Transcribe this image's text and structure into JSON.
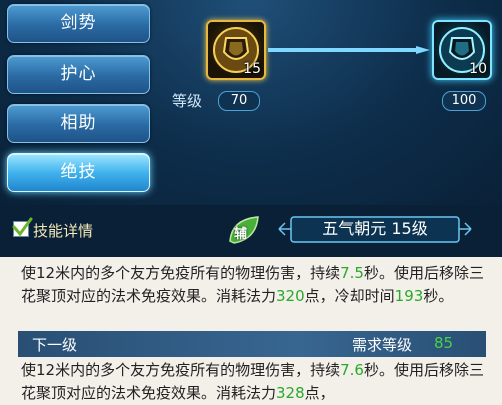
{
  "tabs": [
    {
      "label": "剑势",
      "active": false
    },
    {
      "label": "护心",
      "active": false
    },
    {
      "label": "相助",
      "active": false
    },
    {
      "label": "绝技",
      "active": true
    }
  ],
  "upgrade": {
    "current_icon_count": "15",
    "next_icon_count": "10",
    "level_label": "等级",
    "current_level": "70",
    "next_level": "100"
  },
  "detail": {
    "checkbox_checked": true,
    "label": "技能详情",
    "assist_badge": "辅",
    "skill_name": "五气朝元 15级"
  },
  "description": {
    "current": {
      "p1": "使12米内的多个友方免疫所有的物理伤害，持续",
      "duration": "7.5",
      "p2": "秒。使用后移除三花聚顶对应的法术免疫效果。消耗法力",
      "mana": "320",
      "p3": "点，冷却时间",
      "cooldown": "193",
      "p4": "秒。"
    },
    "next_bar": {
      "label": "下一级",
      "req_label": "需求等级",
      "req_level": "85"
    },
    "next": {
      "p1": "使12米内的多个友方免疫所有的物理伤害，持续",
      "duration": "7.6",
      "p2": "秒。使用后移除三花聚顶对应的法术免疫效果。消耗法力",
      "mana": "328",
      "p3": "点，"
    }
  },
  "colors": {
    "highlight": "#2aa82a",
    "tab_active": "#42b3ee",
    "gold_frame": "#e8b93c",
    "blue_frame": "#7fe4ff"
  }
}
